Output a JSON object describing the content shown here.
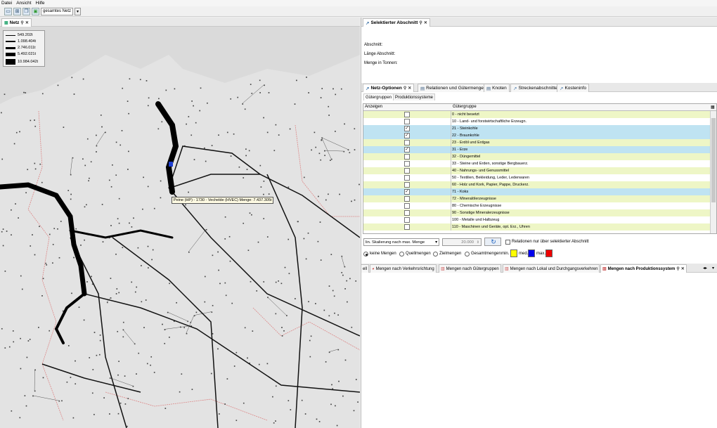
{
  "menu": [
    "Datei",
    "Ansicht",
    "Hilfe"
  ],
  "toolbar": {
    "network_select": "gesamtes Netz"
  },
  "left_tab": {
    "label": "Netz"
  },
  "legend": {
    "items": [
      {
        "label": "549.202t",
        "stroke": 1
      },
      {
        "label": "1.098.404t",
        "stroke": 2
      },
      {
        "label": "2.746.011t",
        "stroke": 3
      },
      {
        "label": "5.492.021t",
        "stroke": 5
      },
      {
        "label": "10.984.042t",
        "stroke": 8
      }
    ]
  },
  "map_tooltip": "Peine (HP) - 1730 - Vechelde (HVEC) Menge: 7.437.305t",
  "selected_section": {
    "tab_label": "Selektierter Abschnitt",
    "labels": {
      "abschnitt": "Abschnitt:",
      "laenge": "Länge Abschnitt:",
      "menge": "Menge in Tonnen:"
    }
  },
  "netz_tabs": [
    {
      "label": "Netz-Optionen",
      "active": true
    },
    {
      "label": "Relationen und Gütermengen",
      "active": false
    },
    {
      "label": "Knoten",
      "active": false
    },
    {
      "label": "Streckenabschnitte",
      "active": false
    },
    {
      "label": "Kosteninfo",
      "active": false
    }
  ],
  "sub_tabs": [
    "Gütergruppen",
    "Produktionssysteme"
  ],
  "grid": {
    "headers": {
      "anzeigen": "Anzeigen",
      "gruppe": "Gütergruppe"
    },
    "rows": [
      {
        "label": "0 - nicht besetzt",
        "checked": false,
        "color": "#eef6c6"
      },
      {
        "label": "10 - Land- und forstwirtschaftliche Erzeugn.",
        "checked": false,
        "color": "#ffffff"
      },
      {
        "label": "21 - Steinkohle",
        "checked": true,
        "color": "#bfe3f2"
      },
      {
        "label": "22 - Braunkohle",
        "checked": true,
        "color": "#bfe3f2"
      },
      {
        "label": "23 - Erdöl und Erdgas",
        "checked": false,
        "color": "#eef6c6"
      },
      {
        "label": "31 - Erze",
        "checked": true,
        "color": "#bfe3f2"
      },
      {
        "label": "32 - Düngemittel",
        "checked": false,
        "color": "#eef6c6"
      },
      {
        "label": "33 - Steine und Erden, sonstige Bergbauerz.",
        "checked": false,
        "color": "#ffffff"
      },
      {
        "label": "40 - Nahrungs- und Genussmittel",
        "checked": false,
        "color": "#eef6c6"
      },
      {
        "label": "50 - Textilien, Bekleidung, Leder, Lederwaren",
        "checked": false,
        "color": "#ffffff"
      },
      {
        "label": "60 - Holz und Kork, Papier, Pappe, Druckerz.",
        "checked": false,
        "color": "#eef6c6"
      },
      {
        "label": "71 - Koks",
        "checked": true,
        "color": "#bfe3f2"
      },
      {
        "label": "72 - Mineralölerzeugnisse",
        "checked": false,
        "color": "#eef6c6"
      },
      {
        "label": "80 - Chemische Erzeugnisse",
        "checked": false,
        "color": "#ffffff"
      },
      {
        "label": "90 - Sonstige Mineralerzeugnisse",
        "checked": false,
        "color": "#eef6c6"
      },
      {
        "label": "100 - Metalle und Halbzeug",
        "checked": false,
        "color": "#ffffff"
      },
      {
        "label": "110 - Maschinen und Geräte, opt. Erz., Uhren",
        "checked": false,
        "color": "#eef6c6"
      }
    ]
  },
  "controls": {
    "scaling": "lin. Skalierung nach max. Menge",
    "scaling_value": "20.000",
    "relations_checkbox": "Relationen nur über selektierter Abschnitt",
    "radios": [
      {
        "label": "keine Mengen",
        "selected": true
      },
      {
        "label": "Quellmengen",
        "selected": false
      },
      {
        "label": "Zielmengen",
        "selected": false
      },
      {
        "label": "Gesamtmengen",
        "selected": false
      }
    ],
    "min_label": "min.",
    "med_label": "med.",
    "max_label": "max.",
    "colors": {
      "min": "#ffff00",
      "med": "#0000ee",
      "max": "#ee0000"
    }
  },
  "bottom_tabs": [
    {
      "label": "Mengen nach Verkehrsrichtung",
      "active": false
    },
    {
      "label": "Mengen nach Gütergruppen",
      "active": false
    },
    {
      "label": "Mengen nach Lokal und Durchgangsverkehren",
      "active": false
    },
    {
      "label": "Mengen nach Produktionssystem",
      "active": true
    }
  ]
}
